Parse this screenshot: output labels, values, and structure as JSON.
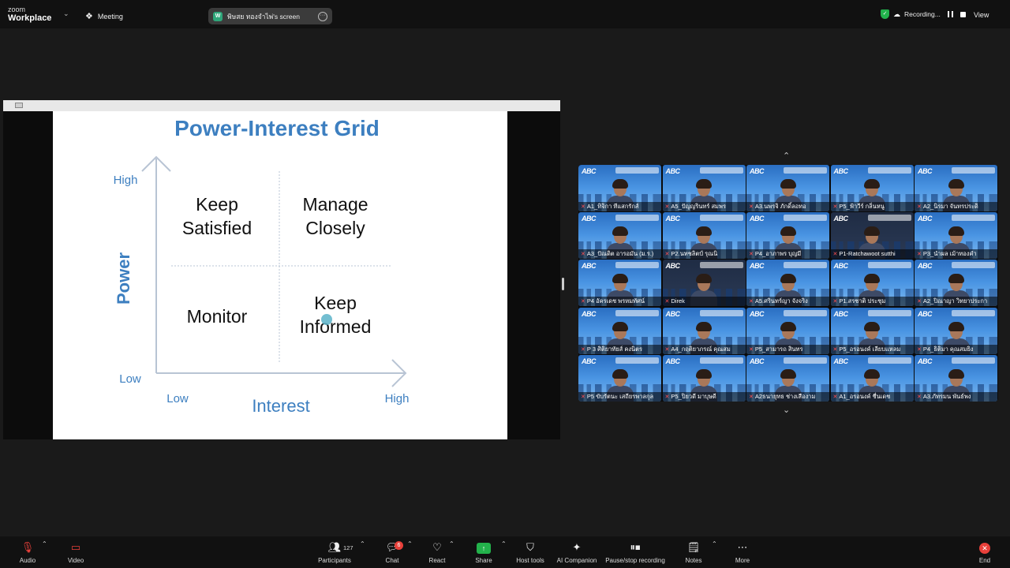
{
  "topbar": {
    "logo_line1": "zoom",
    "logo_line2": "Workplace",
    "meeting_label": "Meeting",
    "share_initial": "W",
    "share_label": "พิษสย ทองจำไพ่'s screen",
    "recording_label": "Recording...",
    "view_label": "View"
  },
  "slide": {
    "title": "Power-Interest Grid",
    "y_label": "Power",
    "x_label": "Interest",
    "y_high": "High",
    "y_low": "Low",
    "x_low": "Low",
    "x_high": "High",
    "q_top_left": [
      "Keep",
      "Satisfied"
    ],
    "q_top_right": [
      "Manage",
      "Closely"
    ],
    "q_bottom_left": [
      "Monitor"
    ],
    "q_bottom_right": [
      "Keep",
      "Informed"
    ],
    "title_color": "#3d7fc0",
    "axis_color": "#b8c4d4"
  },
  "gallery": {
    "participants": [
      {
        "name": "A1_ทิจิกา ทีแสกรักส์",
        "style": "blue"
      },
      {
        "name": "A5_ปัญญรินทร์ สมพร",
        "style": "blue"
      },
      {
        "name": "A3.นพรจิ ภักดิ์ลอทอ",
        "style": "blue"
      },
      {
        "name": "P5_ฟ้าวีร์ กลิ่นหนู",
        "style": "blue"
      },
      {
        "name": "A2_นิรมา จันทรประดิ",
        "style": "blue"
      },
      {
        "name": "A3_ปัณดิต อารอมัน (ม.ร.)",
        "style": "blue"
      },
      {
        "name": "P2.นทชลิตป์ รุณนิ",
        "style": "blue"
      },
      {
        "name": "P4_อาภาพร บุญมี",
        "style": "blue"
      },
      {
        "name": "P1-Ratchawoot sutthi",
        "style": "dark"
      },
      {
        "name": "P3_นำผล เม้าทองคำ",
        "style": "blue"
      },
      {
        "name": "P4 อัครเดช พรหมทัศน์",
        "style": "blue"
      },
      {
        "name": "Direk",
        "style": "dark"
      },
      {
        "name": "A5.ศรินทร์ญา จังจริง",
        "style": "blue"
      },
      {
        "name": "P1.สรชาติ ประชุม",
        "style": "blue"
      },
      {
        "name": "A2_ปิณาญา วิทยาประกา",
        "style": "blue"
      },
      {
        "name": "P 3 ศิติยาทัยส์ คงนิตร",
        "style": "blue"
      },
      {
        "name": "A4_กฤติยาภรณ์ คุณสม",
        "style": "blue"
      },
      {
        "name": "P5_สามารถ สินทร",
        "style": "blue"
      },
      {
        "name": "P5_อรอนงค์ เลียบแหลม",
        "style": "blue"
      },
      {
        "name": "P4_ธิติมา คุณสมยิง",
        "style": "blue"
      },
      {
        "name": "P5 ขับรัตนะ เสถียรพาลกุล",
        "style": "blue"
      },
      {
        "name": "P5_ปิยวดี มาบุษดี",
        "style": "blue"
      },
      {
        "name": "A2ธนายุทธ ช่างเสืองาม",
        "style": "blue"
      },
      {
        "name": "A1_อรอนงค์ ชื่นเดช",
        "style": "blue"
      },
      {
        "name": "A3.ภัทรมน พันธ์พง",
        "style": "blue"
      }
    ]
  },
  "toolbar": {
    "audio": "Audio",
    "video": "Video",
    "participants": "Participants",
    "participants_count": "127",
    "chat": "Chat",
    "chat_badge": "6",
    "react": "React",
    "share": "Share",
    "host_tools": "Host tools",
    "ai_companion": "AI Companion",
    "pause_stop": "Pause/stop recording",
    "notes": "Notes",
    "more": "More",
    "end": "End"
  },
  "colors": {
    "accent_green": "#23b24b",
    "end_red": "#e8403a",
    "background": "#1a1a1a"
  }
}
